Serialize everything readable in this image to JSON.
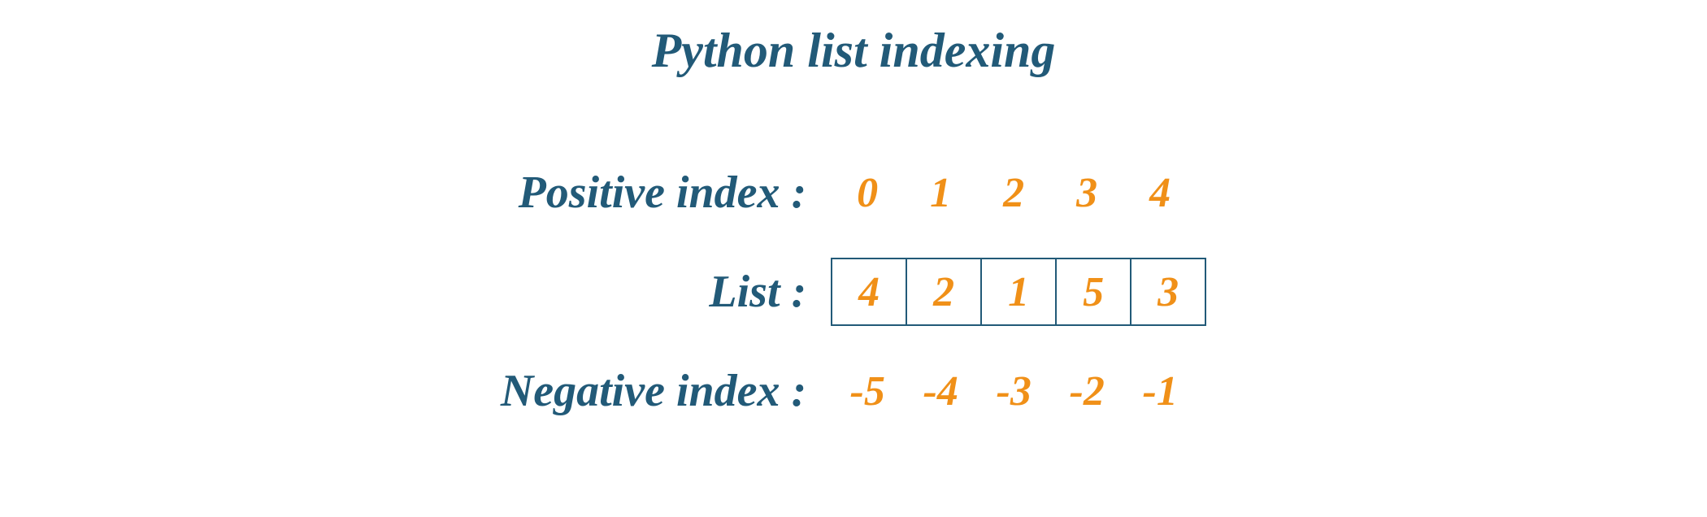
{
  "title": "Python list indexing",
  "rows": {
    "positive": {
      "label": "Positive index :",
      "cells": [
        "0",
        "1",
        "2",
        "3",
        "4"
      ]
    },
    "list": {
      "label": "List :",
      "cells": [
        "4",
        "2",
        "1",
        "5",
        "3"
      ]
    },
    "negative": {
      "label": "Negative index :",
      "cells": [
        "-5",
        "-4",
        "-3",
        "-2",
        "-1"
      ]
    }
  }
}
